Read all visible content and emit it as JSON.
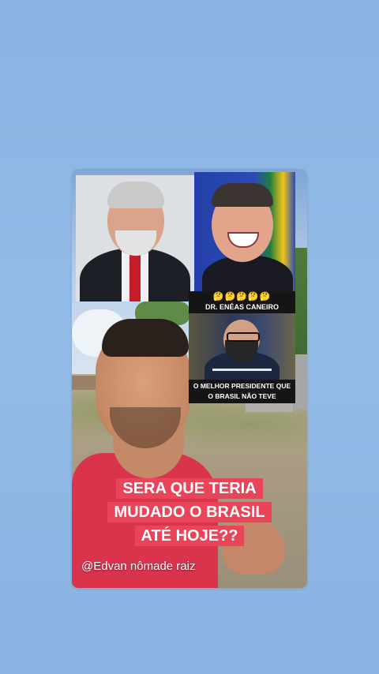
{
  "story": {
    "images": {
      "left_top": "lula-portrait",
      "right_top": "bolsonaro-portrait",
      "right_mid": "eneas-portrait"
    },
    "emojis": "🤔🤔🤔🤔🤔",
    "caption_top": "DR. ENÉAS CANEIRO",
    "caption_bottom_line1": "O MELHOR PRESIDENTE QUE",
    "caption_bottom_line2": "O BRASIL NÃO TEVE",
    "overlay_line1": "SERA QUE TERIA",
    "overlay_line2": "MUDADO O BRASIL",
    "overlay_line3": "ATÉ HOJE??",
    "handle": "@Edvan nômade raiz",
    "accent_color": "#e8455a"
  }
}
